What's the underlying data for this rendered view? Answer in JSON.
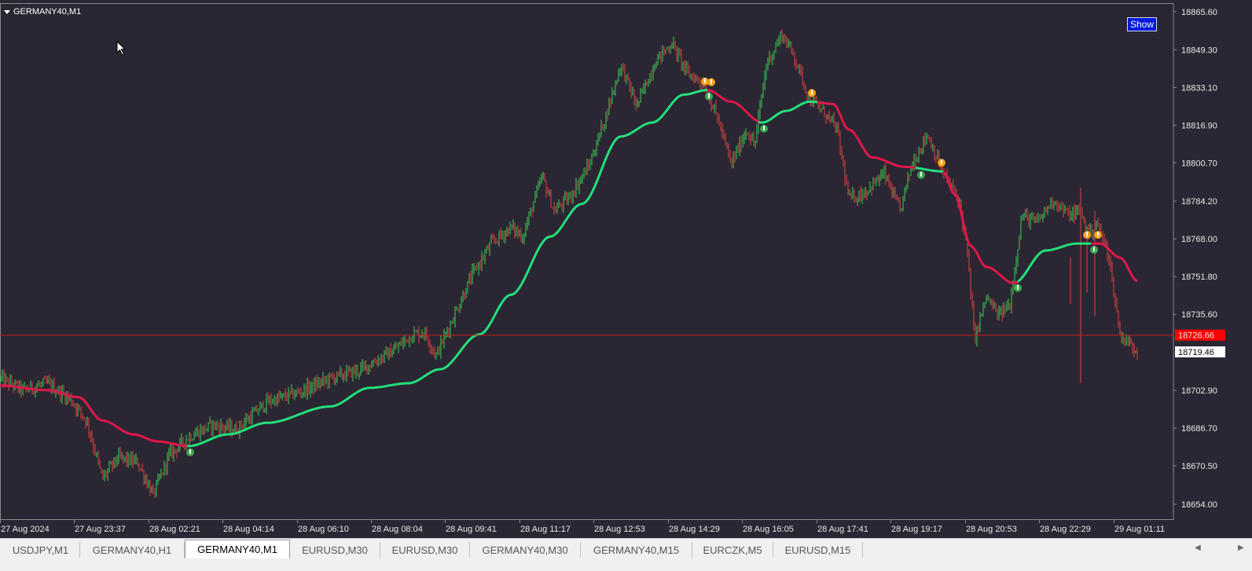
{
  "window": {
    "symbol_label": "GERMANY40,M1",
    "show_button": "Show"
  },
  "colors": {
    "background": "#2b2633",
    "bull_candle": "#39d353",
    "bear_candle": "#e0443f",
    "ma_up": "#22e07a",
    "ma_down": "#e0174a",
    "price_line": "#c81e1e",
    "ask_badge": "#ff0000",
    "bid_badge": "#ffffff",
    "signal_buy": "#3ca84e",
    "signal_sell": "#f2a31a"
  },
  "price_axis": {
    "ticks": [
      "18865.60",
      "18849.30",
      "18833.10",
      "18816.90",
      "18800.70",
      "18784.20",
      "18768.00",
      "18751.80",
      "18735.60",
      "18702.90",
      "18686.70",
      "18670.50",
      "18654.00"
    ],
    "current_price_label": "18726.66",
    "current_price": 18726.66,
    "bid_label": "18719.46",
    "bid_price": 18719.46
  },
  "time_axis": {
    "ticks": [
      "27 Aug 2024",
      "27 Aug 23:37",
      "28 Aug 02:21",
      "28 Aug 04:14",
      "28 Aug 06:10",
      "28 Aug 08:04",
      "28 Aug 09:41",
      "28 Aug 11:17",
      "28 Aug 12:53",
      "28 Aug 14:29",
      "28 Aug 16:05",
      "28 Aug 17:41",
      "28 Aug 19:17",
      "28 Aug 20:53",
      "28 Aug 22:29",
      "29 Aug 01:11"
    ]
  },
  "chart_data": {
    "type": "candlestick",
    "symbol": "GERMANY40",
    "timeframe": "M1",
    "ylim": [
      18650,
      18870
    ],
    "price_path": [
      [
        0,
        18708
      ],
      [
        30,
        18703
      ],
      [
        60,
        18706
      ],
      [
        90,
        18699
      ],
      [
        110,
        18690
      ],
      [
        120,
        18678
      ],
      [
        130,
        18665
      ],
      [
        150,
        18674
      ],
      [
        175,
        18672
      ],
      [
        195,
        18658
      ],
      [
        215,
        18675
      ],
      [
        240,
        18683
      ],
      [
        270,
        18688
      ],
      [
        300,
        18686
      ],
      [
        340,
        18698
      ],
      [
        380,
        18702
      ],
      [
        420,
        18708
      ],
      [
        460,
        18712
      ],
      [
        500,
        18720
      ],
      [
        525,
        18727
      ],
      [
        540,
        18728
      ],
      [
        555,
        18718
      ],
      [
        575,
        18733
      ],
      [
        600,
        18752
      ],
      [
        625,
        18766
      ],
      [
        650,
        18773
      ],
      [
        665,
        18769
      ],
      [
        690,
        18795
      ],
      [
        705,
        18780
      ],
      [
        725,
        18786
      ],
      [
        750,
        18800
      ],
      [
        770,
        18820
      ],
      [
        790,
        18843
      ],
      [
        810,
        18825
      ],
      [
        835,
        18845
      ],
      [
        855,
        18852
      ],
      [
        875,
        18839
      ],
      [
        895,
        18835
      ],
      [
        915,
        18818
      ],
      [
        930,
        18800
      ],
      [
        950,
        18815
      ],
      [
        960,
        18808
      ],
      [
        975,
        18843
      ],
      [
        995,
        18856
      ],
      [
        1010,
        18847
      ],
      [
        1030,
        18828
      ],
      [
        1050,
        18822
      ],
      [
        1065,
        18815
      ],
      [
        1080,
        18785
      ],
      [
        1100,
        18788
      ],
      [
        1125,
        18796
      ],
      [
        1145,
        18780
      ],
      [
        1160,
        18800
      ],
      [
        1180,
        18813
      ],
      [
        1200,
        18796
      ],
      [
        1220,
        18785
      ],
      [
        1230,
        18765
      ],
      [
        1240,
        18725
      ],
      [
        1255,
        18743
      ],
      [
        1270,
        18735
      ],
      [
        1285,
        18740
      ],
      [
        1300,
        18778
      ],
      [
        1320,
        18775
      ],
      [
        1340,
        18785
      ],
      [
        1360,
        18778
      ],
      [
        1375,
        18780
      ],
      [
        1385,
        18770
      ],
      [
        1395,
        18775
      ],
      [
        1410,
        18762
      ],
      [
        1425,
        18727
      ],
      [
        1440,
        18722
      ],
      [
        1447,
        18720
      ]
    ],
    "moving_average": [
      [
        0,
        18705
      ],
      [
        60,
        18703
      ],
      [
        100,
        18700
      ],
      [
        130,
        18690
      ],
      [
        170,
        18684
      ],
      [
        200,
        18681
      ],
      [
        240,
        18679
      ],
      [
        290,
        18684
      ],
      [
        340,
        18689
      ],
      [
        420,
        18696
      ],
      [
        470,
        18704
      ],
      [
        520,
        18706
      ],
      [
        560,
        18712
      ],
      [
        610,
        18727
      ],
      [
        650,
        18744
      ],
      [
        700,
        18769
      ],
      [
        740,
        18783
      ],
      [
        790,
        18812
      ],
      [
        830,
        18818
      ],
      [
        870,
        18830
      ],
      [
        900,
        18832
      ],
      [
        930,
        18827
      ],
      [
        970,
        18818
      ],
      [
        1000,
        18823
      ],
      [
        1030,
        18827
      ],
      [
        1060,
        18826
      ],
      [
        1080,
        18815
      ],
      [
        1110,
        18803
      ],
      [
        1150,
        18799
      ],
      [
        1200,
        18797
      ],
      [
        1215,
        18787
      ],
      [
        1235,
        18765
      ],
      [
        1255,
        18756
      ],
      [
        1290,
        18749
      ],
      [
        1330,
        18763
      ],
      [
        1370,
        18766
      ],
      [
        1400,
        18766
      ],
      [
        1425,
        18760
      ],
      [
        1447,
        18750
      ]
    ],
    "ma_color_switches": [
      {
        "from": 0,
        "to": 238,
        "color": "down"
      },
      {
        "from": 238,
        "to": 900,
        "color": "up"
      },
      {
        "from": 900,
        "to": 965,
        "color": "down"
      },
      {
        "from": 965,
        "to": 1040,
        "color": "up"
      },
      {
        "from": 1040,
        "to": 1165,
        "color": "down"
      },
      {
        "from": 1165,
        "to": 1200,
        "color": "up"
      },
      {
        "from": 1200,
        "to": 1295,
        "color": "down"
      },
      {
        "from": 1295,
        "to": 1388,
        "color": "up"
      },
      {
        "from": 1388,
        "to": 1447,
        "color": "down"
      }
    ],
    "signals": [
      {
        "x": 242,
        "type": "buy"
      },
      {
        "x": 897,
        "type": "sell"
      },
      {
        "x": 905,
        "type": "sell"
      },
      {
        "x": 902,
        "type": "buy"
      },
      {
        "x": 972,
        "type": "buy"
      },
      {
        "x": 1033,
        "type": "sell"
      },
      {
        "x": 1172,
        "type": "buy"
      },
      {
        "x": 1198,
        "type": "sell"
      },
      {
        "x": 1295,
        "type": "buy"
      },
      {
        "x": 1383,
        "type": "sell"
      },
      {
        "x": 1397,
        "type": "sell"
      },
      {
        "x": 1392,
        "type": "buy"
      }
    ]
  },
  "tabs": [
    {
      "label": "USDJPY,M1",
      "active": false
    },
    {
      "label": "GERMANY40,H1",
      "active": false
    },
    {
      "label": "GERMANY40,M1",
      "active": true
    },
    {
      "label": "EURUSD,M30",
      "active": false
    },
    {
      "label": "EURUSD,M30",
      "active": false
    },
    {
      "label": "GERMANY40,M30",
      "active": false
    },
    {
      "label": "GERMANY40,M15",
      "active": false
    },
    {
      "label": "EURCZK,M5",
      "active": false
    },
    {
      "label": "EURUSD,M15",
      "active": false
    }
  ],
  "tab_scroll": {
    "left_icon": "triangle-left",
    "right_icon": "triangle-right"
  }
}
